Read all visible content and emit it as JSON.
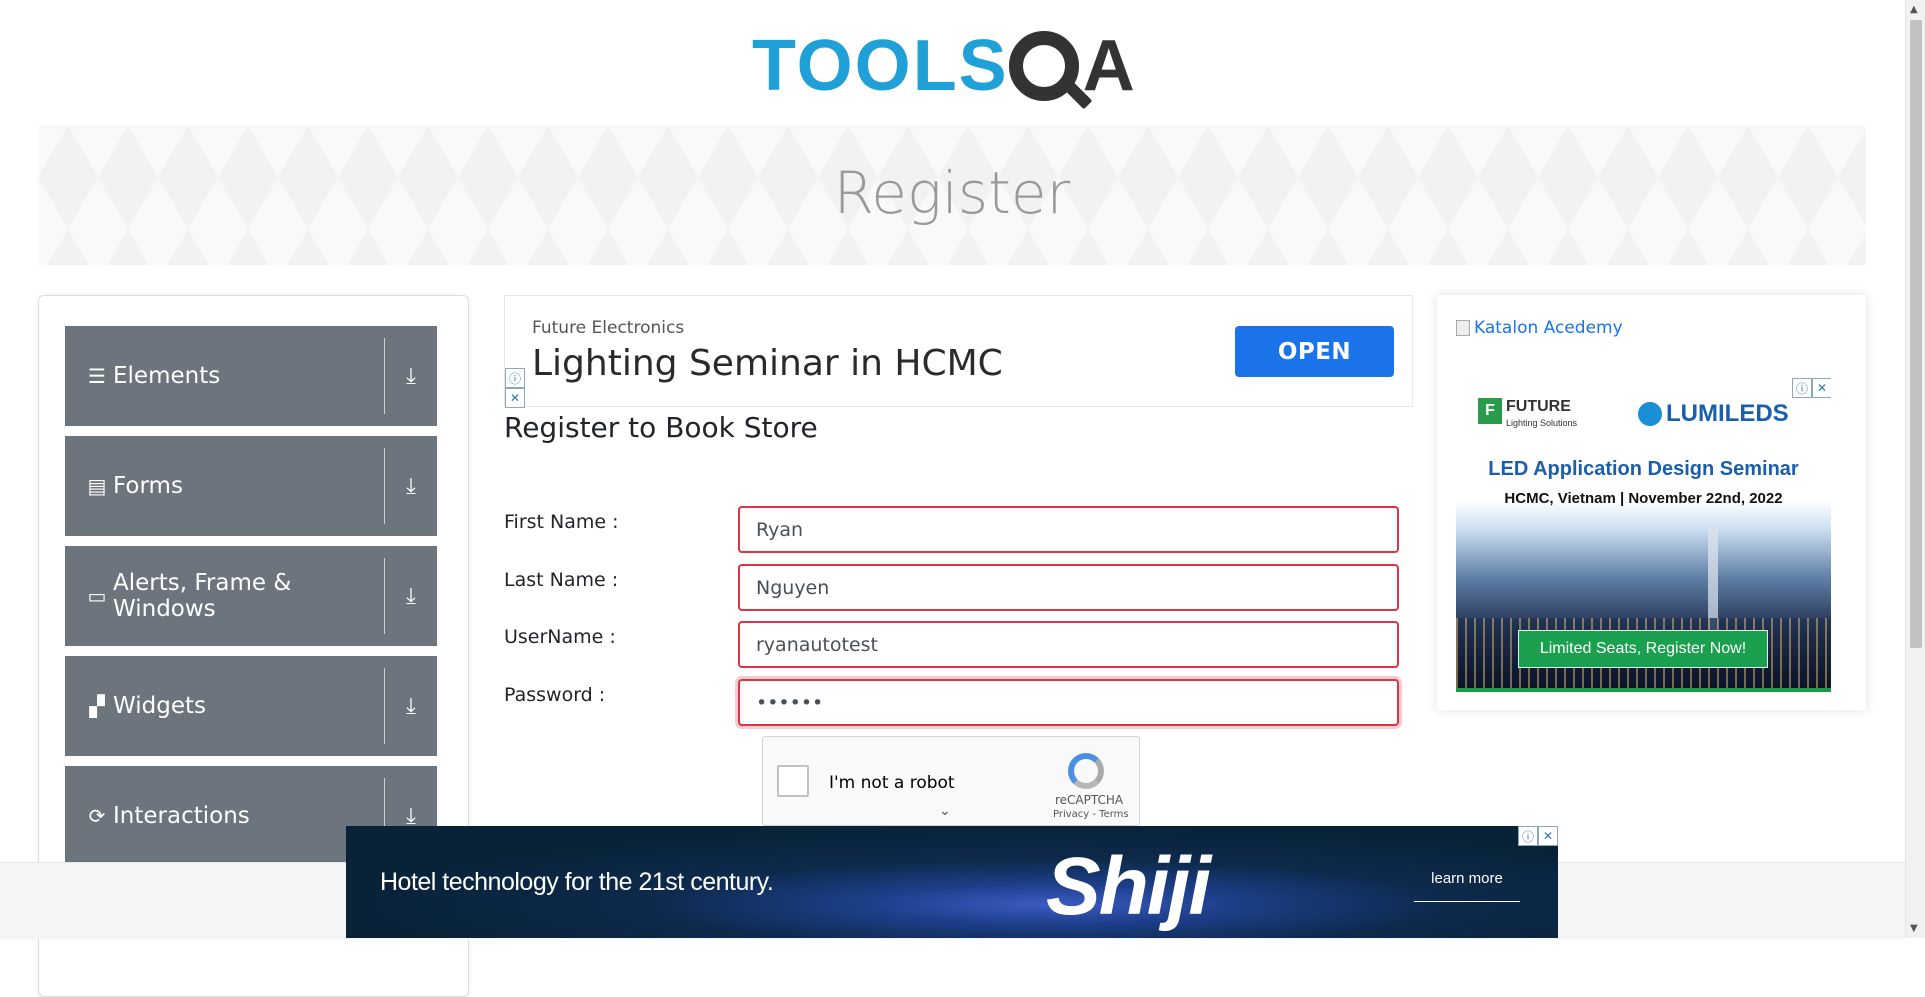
{
  "header": {
    "logo_tools": "TOOLS",
    "logo_qa": "A"
  },
  "banner": {
    "title": "Register"
  },
  "sidebar": {
    "groups": [
      {
        "label": "Elements",
        "icon": "hamburger-icon"
      },
      {
        "label": "Forms",
        "icon": "document-icon"
      },
      {
        "label": "Alerts, Frame & Windows",
        "icon": "window-icon"
      },
      {
        "label": "Widgets",
        "icon": "widgets-icon"
      },
      {
        "label": "Interactions",
        "icon": "interactions-icon"
      }
    ]
  },
  "top_ad": {
    "brand": "Future Electronics",
    "headline": "Lighting Seminar in HCMC",
    "button": "OPEN"
  },
  "form": {
    "title": "Register to Book Store",
    "fields": [
      {
        "label": "First Name :",
        "value": "Ryan"
      },
      {
        "label": "Last Name :",
        "value": "Nguyen"
      },
      {
        "label": "UserName :",
        "value": "ryanautotest"
      },
      {
        "label": "Password :",
        "value": "••••••"
      }
    ]
  },
  "recaptcha": {
    "label": "I'm not a robot",
    "brand": "reCAPTCHA",
    "terms": "Privacy - Terms"
  },
  "right_ad": {
    "katalon_alt": "Katalon Acedemy",
    "future": "FUTURE",
    "future_sub": "Lighting Solutions",
    "lumileds": "LUMILEDS",
    "title": "LED Application Design Seminar",
    "subtitle": "HCMC, Vietnam | November 22nd, 2022",
    "cta": "Limited Seats, Register Now!"
  },
  "bottom_ad": {
    "text": "Hotel technology for the 21st century.",
    "logo": "Shiji",
    "cta": "learn more"
  },
  "colors": {
    "accent": "#1fa0d6",
    "sidebar_bg": "#6c757d",
    "error_border": "#dc3545",
    "ad_button": "#1a73e8"
  }
}
